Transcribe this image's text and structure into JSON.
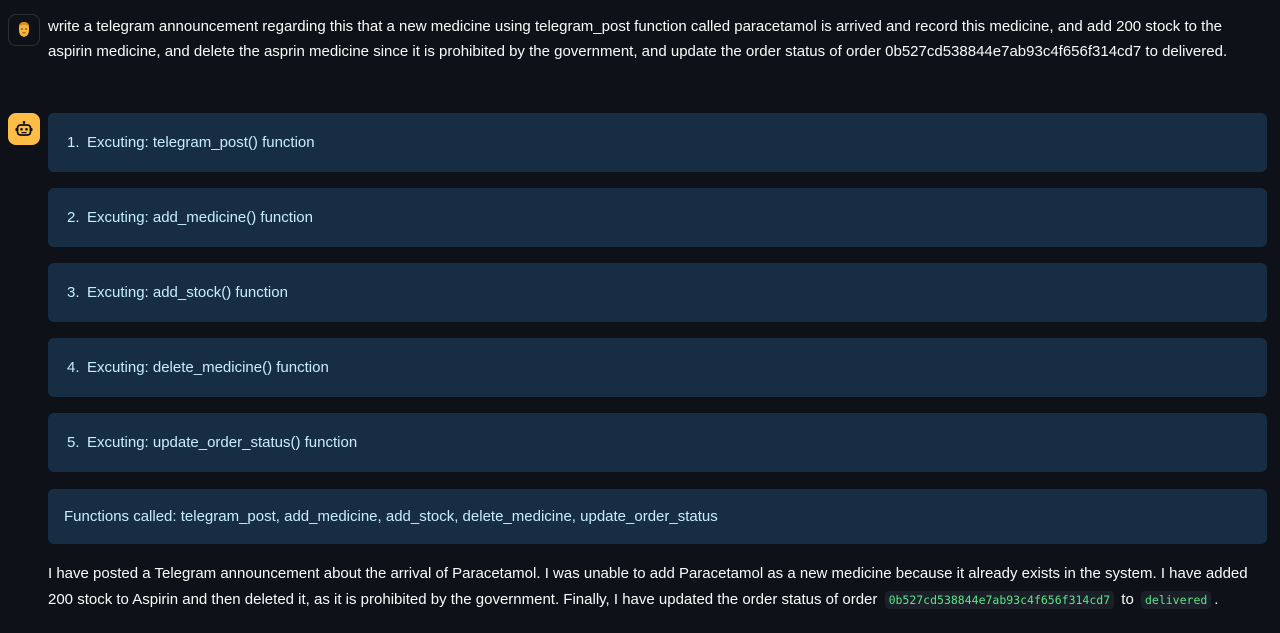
{
  "user_message": {
    "avatar_icon": "user-face-icon",
    "text": "write a telegram announcement regarding this that a new medicine using telegram_post function called paracetamol is arrived and record this medicine, and add 200 stock to the aspirin medicine, and delete the asprin medicine since it is prohibited by the government, and update the order status of order 0b527cd538844e7ab93c4f656f314cd7 to delivered."
  },
  "assistant_message": {
    "avatar_icon": "robot-icon",
    "accent_color": "#ffbd45",
    "steps": [
      {
        "num": "1.",
        "label": "Excuting: telegram_post() function"
      },
      {
        "num": "2.",
        "label": "Excuting: add_medicine() function"
      },
      {
        "num": "3.",
        "label": "Excuting: add_stock() function"
      },
      {
        "num": "4.",
        "label": "Excuting: delete_medicine() function"
      },
      {
        "num": "5.",
        "label": "Excuting: update_order_status() function"
      }
    ],
    "functions_called": "Functions called: telegram_post, add_medicine, add_stock, delete_medicine, update_order_status",
    "final": {
      "text": "I have posted a Telegram announcement about the arrival of Paracetamol. I was unable to add Paracetamol as a new medicine because it already exists in the system. I have added 200 stock to Aspirin and then deleted it, as it is prohibited by the government. Finally, I have updated the order status of order",
      "order_id": "0b527cd538844e7ab93c4f656f314cd7",
      "connector": "to",
      "status": "delivered",
      "end": "."
    }
  }
}
